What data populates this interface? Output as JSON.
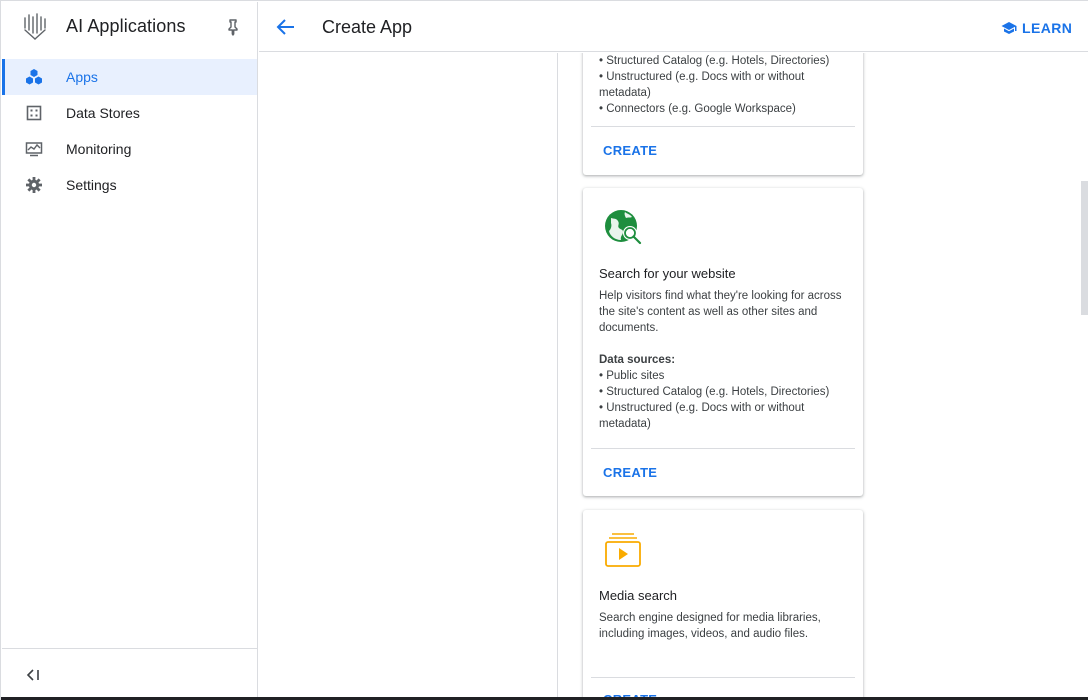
{
  "sidebar": {
    "title": "AI Applications",
    "items": [
      {
        "label": "Apps",
        "icon": "apps-cubes-icon",
        "active": true
      },
      {
        "label": "Data Stores",
        "icon": "data-stores-icon",
        "active": false
      },
      {
        "label": "Monitoring",
        "icon": "monitoring-icon",
        "active": false
      },
      {
        "label": "Settings",
        "icon": "gear-icon",
        "active": false
      }
    ]
  },
  "header": {
    "title": "Create App",
    "learn_label": "LEARN"
  },
  "cards": [
    {
      "sources": [
        "• Structured Catalog (e.g. Hotels, Directories)",
        "• Unstructured (e.g. Docs with or without",
        "metadata)",
        "• Connectors (e.g. Google Workspace)"
      ],
      "create_label": "CREATE"
    },
    {
      "icon": "globe-search-icon",
      "title": "Search for your website",
      "description": "Help visitors find what they're looking for across the site's content as well as other sites and documents.",
      "sources_title": "Data sources:",
      "sources": [
        "• Public sites",
        "• Structured Catalog (e.g. Hotels, Directories)",
        "• Unstructured (e.g. Docs with or without",
        "metadata)"
      ],
      "create_label": "CREATE"
    },
    {
      "icon": "media-play-icon",
      "title": "Media search",
      "description": "Search engine designed for media libraries, including images, videos, and audio files.",
      "create_label": "CREATE"
    }
  ],
  "colors": {
    "accent": "#1a73e8",
    "active_bg": "#e8f0fe",
    "globe": "#1e8e3e",
    "media": "#f9ab00"
  }
}
